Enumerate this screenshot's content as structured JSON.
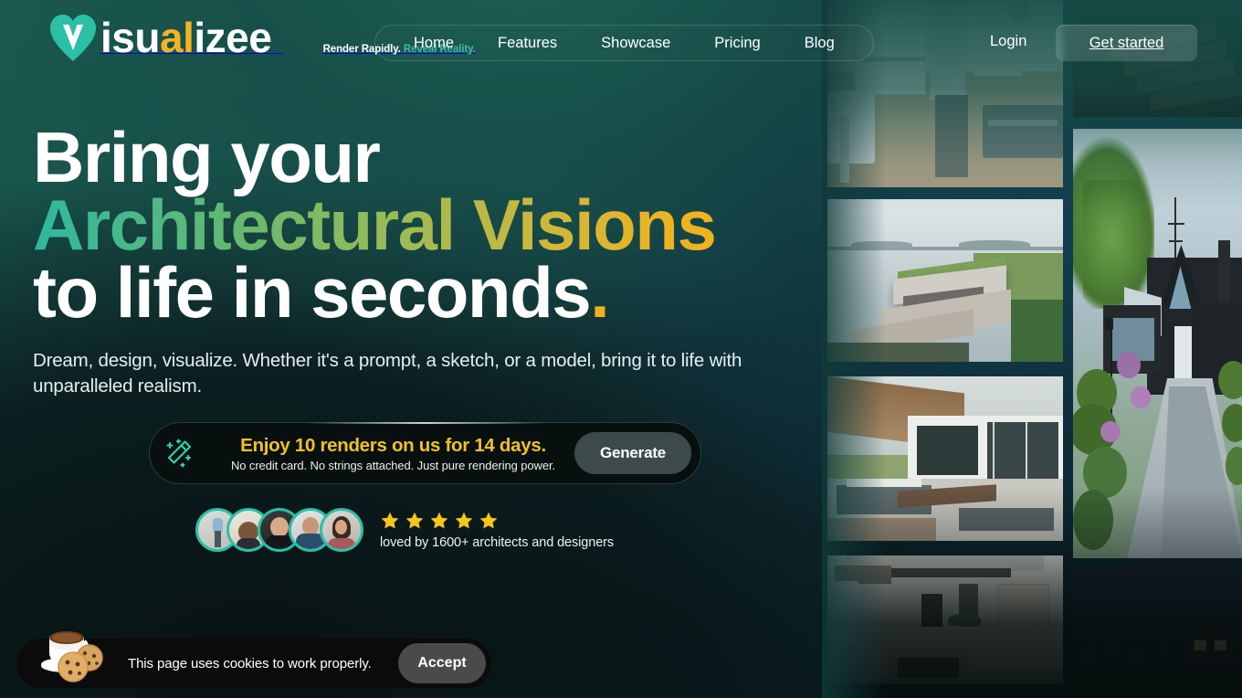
{
  "brand": {
    "logo_mark": "v-heart-icon",
    "name_parts": [
      {
        "text": "isu",
        "color": "#ffffff"
      },
      {
        "text": "a",
        "color": "#f2b422"
      },
      {
        "text": "l",
        "color": "#f2b422"
      },
      {
        "text": "izee",
        "color": "#ffffff"
      }
    ],
    "tagline_1": "Render Rapidly.",
    "tagline_2": "Reveal Reality.",
    "accent_teal": "#2bbfa6",
    "accent_gold": "#f2b422"
  },
  "header": {
    "nav": [
      {
        "label": "Home"
      },
      {
        "label": "Features"
      },
      {
        "label": "Showcase"
      },
      {
        "label": "Pricing"
      },
      {
        "label": "Blog"
      }
    ],
    "login_label": "Login",
    "get_started_label": "Get started"
  },
  "hero": {
    "line1": "Bring your",
    "line2": "Architectural Visions",
    "line3": "to life in seconds",
    "line3_dot": ".",
    "subtitle": "Dream, design, visualize. Whether it's a prompt, a sketch, or a model, bring it to life with unparalleled realism."
  },
  "promo": {
    "icon": "magic-wand-icon",
    "title": "Enjoy 10 renders on us for 14 days.",
    "subtitle": "No credit card. No strings attached. Just pure rendering power.",
    "button_label": "Generate"
  },
  "social_proof": {
    "avatar_count": 5,
    "avatars": [
      {
        "name": "avatar-1"
      },
      {
        "name": "avatar-2"
      },
      {
        "name": "avatar-3"
      },
      {
        "name": "avatar-4"
      },
      {
        "name": "avatar-5"
      }
    ],
    "stars": 5,
    "star_color": "#f5c518",
    "label": "loved by 1600+ architects and designers"
  },
  "cookie_banner": {
    "emoji": "coffee-and-cookies-icon",
    "message": "This page uses cookies to work properly.",
    "accept_label": "Accept"
  },
  "gallery": {
    "column_1": [
      {
        "name": "render-interior-kitchen-dining"
      },
      {
        "name": "render-lakeside-modern-house"
      },
      {
        "name": "render-poolside-pavilion-house"
      },
      {
        "name": "render-interior-living-room"
      }
    ],
    "column_2": [
      {
        "name": "render-dark-stairs"
      },
      {
        "name": "render-gothic-house-garden-path"
      },
      {
        "name": "render-night-forest-cabin"
      }
    ]
  }
}
